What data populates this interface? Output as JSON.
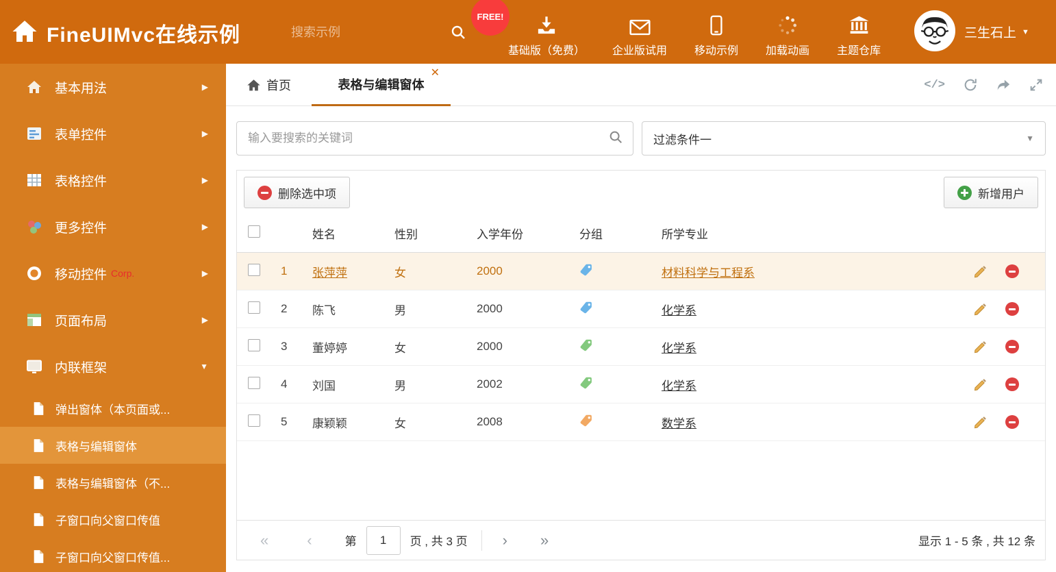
{
  "header": {
    "title": "FineUIMvc在线示例",
    "search_placeholder": "搜索示例",
    "free_badge": "FREE!",
    "nav": [
      {
        "label": "基础版（免费）"
      },
      {
        "label": "企业版试用"
      },
      {
        "label": "移动示例"
      },
      {
        "label": "加载动画"
      },
      {
        "label": "主题仓库"
      }
    ],
    "user_name": "三生石上"
  },
  "sidebar": {
    "items": [
      {
        "label": "基本用法"
      },
      {
        "label": "表单控件"
      },
      {
        "label": "表格控件"
      },
      {
        "label": "更多控件"
      },
      {
        "label": "移动控件",
        "badge": "Corp."
      },
      {
        "label": "页面布局"
      },
      {
        "label": "内联框架"
      }
    ],
    "subitems": [
      {
        "label": "弹出窗体（本页面或..."
      },
      {
        "label": "表格与编辑窗体"
      },
      {
        "label": "表格与编辑窗体（不..."
      },
      {
        "label": "子窗口向父窗口传值"
      },
      {
        "label": "子窗口向父窗口传值..."
      }
    ]
  },
  "tabs": {
    "home_label": "首页",
    "active_label": "表格与编辑窗体"
  },
  "filter_bar": {
    "search_placeholder": "输入要搜索的关键词",
    "filter_selected": "过滤条件一"
  },
  "toolbar": {
    "delete_label": "删除选中项",
    "add_label": "新增用户"
  },
  "table": {
    "columns": {
      "name": "姓名",
      "gender": "性别",
      "year": "入学年份",
      "group": "分组",
      "major": "所学专业"
    },
    "rows": [
      {
        "num": "1",
        "name": "张萍萍",
        "gender": "女",
        "year": "2000",
        "tag_color": "#6ab4e8",
        "major": "材料科学与工程系"
      },
      {
        "num": "2",
        "name": "陈飞",
        "gender": "男",
        "year": "2000",
        "tag_color": "#6ab4e8",
        "major": "化学系"
      },
      {
        "num": "3",
        "name": "董婷婷",
        "gender": "女",
        "year": "2000",
        "tag_color": "#83c97e",
        "major": "化学系"
      },
      {
        "num": "4",
        "name": "刘国",
        "gender": "男",
        "year": "2002",
        "tag_color": "#83c97e",
        "major": "化学系"
      },
      {
        "num": "5",
        "name": "康颖颖",
        "gender": "女",
        "year": "2008",
        "tag_color": "#f2a963",
        "major": "数学系"
      }
    ]
  },
  "pager": {
    "page_prefix": "第",
    "page_value": "1",
    "page_suffix": "页 , 共 3 页",
    "summary": "显示 1 - 5 条 , 共 12 条"
  },
  "colors": {
    "header_bg": "#d06a0e",
    "sidebar_bg": "#d77d20",
    "sidebar_active_bg": "#e3953a",
    "accent": "#bf6a14",
    "highlight_row_bg": "#fcf3e6",
    "highlight_text": "#c0700f",
    "free_badge_bg": "#f83c3c"
  }
}
